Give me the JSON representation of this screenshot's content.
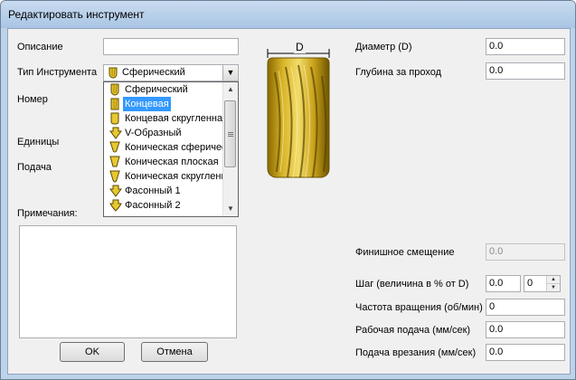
{
  "window": {
    "title": "Редактировать инструмент"
  },
  "left": {
    "description_label": "Описание",
    "description_value": "",
    "tool_type_label": "Тип Инструмента",
    "tool_type_selected": "Сферический",
    "number_label": "Номер",
    "units_label": "Единицы",
    "feed_label": "Подача",
    "notes_label": "Примечания:",
    "notes_value": ""
  },
  "dropdown": {
    "items": [
      {
        "label": "Сферический",
        "icon": "ball-end-tool-icon"
      },
      {
        "label": "Концевая",
        "icon": "end-mill-tool-icon",
        "selected": true
      },
      {
        "label": "Концевая скругленная",
        "icon": "bull-nose-tool-icon"
      },
      {
        "label": "V-Образный",
        "icon": "v-bit-tool-icon"
      },
      {
        "label": "Коническая сферическая",
        "icon": "tapered-ball-tool-icon"
      },
      {
        "label": "Коническая плоская",
        "icon": "tapered-flat-tool-icon"
      },
      {
        "label": "Коническая скругленная",
        "icon": "tapered-bull-tool-icon"
      },
      {
        "label": "Фасонный 1",
        "icon": "form-tool-icon"
      },
      {
        "label": "Фасонный 2",
        "icon": "form-tool-icon"
      }
    ]
  },
  "preview": {
    "dimension_label": "D",
    "tool_color": "#c9a21a"
  },
  "right": {
    "diameter_label": "Диаметр (D)",
    "diameter_value": "0.0",
    "depth_label": "Глубина за проход",
    "depth_value": "0.0",
    "finish_offset_label": "Финишное смещение",
    "finish_offset_value": "0.0",
    "stepover_label": "Шаг (величина в % от D)",
    "stepover_value": "0.0",
    "stepover_percent": "0",
    "spindle_label": "Частота вращения (об/мин)",
    "spindle_value": "0",
    "feed_rate_label": "Рабочая подача (мм/сек)",
    "feed_rate_value": "0.0",
    "plunge_label": "Подача врезания (мм/сек)",
    "plunge_value": "0.0"
  },
  "buttons": {
    "ok": "OK",
    "cancel": "Отмена"
  },
  "colors": {
    "titlebar": "#bcd3ea",
    "selection": "#3399ff",
    "dialog": "#f0f0f0"
  }
}
